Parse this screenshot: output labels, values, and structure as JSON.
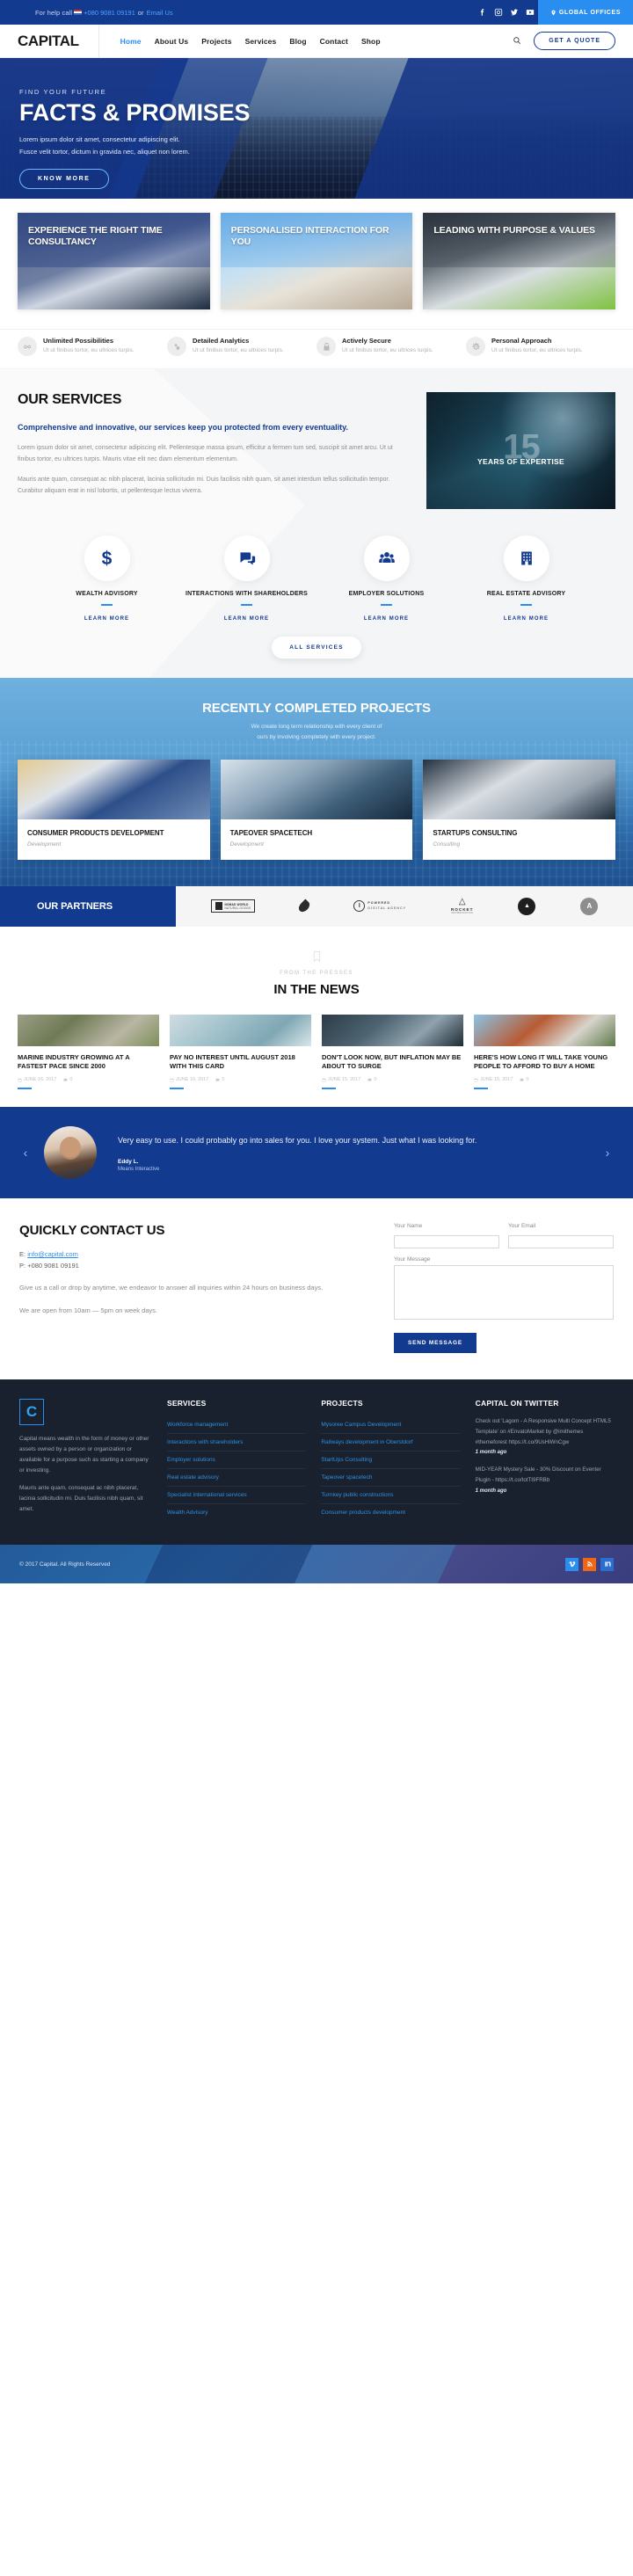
{
  "topbar": {
    "help_text": "For help call",
    "phone": "+080 9081 09191",
    "or_text": "or",
    "email_link": "Email Us",
    "social": [
      "facebook-icon",
      "instagram-icon",
      "twitter-icon",
      "youtube-icon"
    ],
    "global_offices": "GLOBAL OFFICES"
  },
  "nav": {
    "logo": "CAPITAL",
    "links": [
      {
        "label": "Home",
        "active": true
      },
      {
        "label": "About Us",
        "active": false
      },
      {
        "label": "Projects",
        "active": false
      },
      {
        "label": "Services",
        "active": false
      },
      {
        "label": "Blog",
        "active": false
      },
      {
        "label": "Contact",
        "active": false
      },
      {
        "label": "Shop",
        "active": false
      }
    ],
    "quote_button": "GET A QUOTE"
  },
  "hero": {
    "kicker": "FIND YOUR FUTURE",
    "title": "FACTS & PROMISES",
    "desc_line1": "Lorem ipsum dolor sit amet, consectetur adipiscing elit.",
    "desc_line2": "Fusce velit tortor, dictum in gravida nec, aliquet non lorem.",
    "button": "KNOW MORE"
  },
  "feature_cards": [
    {
      "title": "EXPERIENCE THE RIGHT TIME CONSULTANCY"
    },
    {
      "title": "PERSONALISED INTERACTION FOR YOU"
    },
    {
      "title": "LEADING WITH PURPOSE & VALUES"
    }
  ],
  "feature_strip": [
    {
      "icon": "infinity-icon",
      "title": "Unlimited Possibilities",
      "text": "Ut ut finibus tortor, eu ultrices turpis."
    },
    {
      "icon": "analytics-icon",
      "title": "Detailed Analytics",
      "text": "Ut ut finibus tortor, eu ultrices turpis."
    },
    {
      "icon": "lock-icon",
      "title": "Actively Secure",
      "text": "Ut ut finibus tortor, eu ultrices turpis."
    },
    {
      "icon": "gear-icon",
      "title": "Personal Approach",
      "text": "Ut ut finibus tortor, eu ultrices turpis."
    }
  ],
  "services": {
    "heading": "OUR SERVICES",
    "lead": "Comprehensive and innovative, our services keep you protected from every eventuality.",
    "para1": "Lorem ipsum dolor sit amet, consectetur adipiscing elit. Pellentesque massa ipsum, efficitur a fermen tum sed, suscipit sit amet arcu. Ut ut finibus tortor, eu ultrices turpis. Mauris vitae elit nec diam elementum elementum.",
    "para2": "Mauris ante quam, consequat ac nibh placerat, lacinia sollicitudin mi. Duis facilisis nibh quam, sit amet interdum tellus sollicitudin tempor. Curabitur aliquam erat in nisl lobortis, ut pellentesque lectus viverra.",
    "badge_number": "15",
    "badge_caption": "YEARS OF EXPERTISE",
    "items": [
      {
        "icon": "dollar-icon",
        "label": "WEALTH ADVISORY",
        "link": "LEARN MORE"
      },
      {
        "icon": "chat-icon",
        "label": "INTERACTIONS WITH SHAREHOLDERS",
        "link": "LEARN MORE"
      },
      {
        "icon": "people-icon",
        "label": "EMPLOYER SOLUTIONS",
        "link": "LEARN MORE"
      },
      {
        "icon": "building-icon",
        "label": "REAL ESTATE ADVISORY",
        "link": "LEARN MORE"
      }
    ],
    "all_services_button": "ALL SERVICES"
  },
  "projects": {
    "title": "RECENTLY COMPLETED PROJECTS",
    "sub_line1": "We create long term relationship with every client of",
    "sub_line2": "ours by involving completely with every project.",
    "cards": [
      {
        "title": "CONSUMER PRODUCTS DEVELOPMENT",
        "category": "Development"
      },
      {
        "title": "TAPEOVER SPACETECH",
        "category": "Development"
      },
      {
        "title": "STARTUPS CONSULTING",
        "category": "Consulting"
      }
    ]
  },
  "partners": {
    "label": "OUR PARTNERS",
    "logos": [
      {
        "name": "nomad-world-logo",
        "text1": "NOMAD WORLD",
        "text2": "NATURAL GOODS"
      },
      {
        "name": "drop-logo",
        "text1": "",
        "text2": ""
      },
      {
        "name": "powered-digital-agency-logo",
        "text1": "POWERED",
        "text2": "DIGITAL AGENCY"
      },
      {
        "name": "rocket-logo",
        "text1": "ROCKET",
        "text2": "CROWDFUNDING"
      },
      {
        "name": "badge-dark-logo",
        "text1": "",
        "text2": ""
      },
      {
        "name": "badge-gray-logo",
        "text1": "",
        "text2": ""
      }
    ]
  },
  "news": {
    "kicker": "FROM THE PRESSES",
    "title": "IN THE NEWS",
    "cards": [
      {
        "title": "MARINE INDUSTRY GROWING AT A FASTEST PACE SINCE 2000",
        "date": "JUNE 16, 2017",
        "comments": "0"
      },
      {
        "title": "PAY NO INTEREST UNTIL AUGUST 2018 WITH THIS CARD",
        "date": "JUNE 16, 2017",
        "comments": "0"
      },
      {
        "title": "DON'T LOOK NOW, BUT INFLATION MAY BE ABOUT TO SURGE",
        "date": "JUNE 15, 2017",
        "comments": "0"
      },
      {
        "title": "HERE'S HOW LONG IT WILL TAKE YOUNG PEOPLE TO AFFORD TO BUY A HOME",
        "date": "JUNE 15, 2017",
        "comments": "0"
      }
    ]
  },
  "testimonial": {
    "prev": "‹",
    "next": "›",
    "quote": "Very easy to use. I could probably go into sales for you. I love your system. Just what I was looking for.",
    "name": "Eddy L.",
    "role": "Means Interactive"
  },
  "contact": {
    "heading": "QUICKLY CONTACT US",
    "email_label": "E:",
    "email": "info@capital.com",
    "phone_label": "P:",
    "phone": "+080 9081 09191",
    "para1": "Give us a call or drop by anytime, we endeavor to answer all inquiries within 24 hours on business days.",
    "para2": "We are open from 10am — 5pm on week days.",
    "form": {
      "name_label": "Your Name",
      "name_value": "",
      "email_label": "Your Email",
      "email_value": "",
      "message_label": "Your Message",
      "message_value": "",
      "submit": "SEND MESSAGE"
    }
  },
  "footer": {
    "logo_letter": "C",
    "about_p1": "Capital means wealth in the form of money or other assets owned by a person or organization or available for a purpose such as starting a company or investing.",
    "about_p2": "Mauris ante quam, consequat ac nibh placerat, lacinia sollicitudin mi. Duis facilisis nibh quam, sit amet.",
    "services_heading": "SERVICES",
    "services": [
      "Workforce management",
      "Interactions with shareholders",
      "Employer solutions",
      "Real estate advisory",
      "Specialist international services",
      "Wealth Advisory"
    ],
    "projects_heading": "PROJECTS",
    "projects": [
      "Mysoree Campus Development",
      "Railways development in Oberstdorf",
      "StartUps Consulting",
      "Tapeover spacetech",
      "Turnkey public constructions",
      "Consumer products development"
    ],
    "twitter_heading": "CAPITAL ON TWITTER",
    "tweets": [
      {
        "text": "Check out 'Lagom - A Responsive Multi Concept HTML5 Template' on #EnvatoMarket by @imithemes #themeforest https://t.co/9UsHiWnCgw",
        "time": "1 month ago"
      },
      {
        "text": "MID-YEAR Mystery Sale - 30% Discount on Eventer Plugin - https://t.co/totTI9FRBb",
        "time": "1 month ago"
      }
    ],
    "copyright": "© 2017 Capital. All Rights Reserved",
    "social": [
      "vimeo-icon",
      "rss-icon",
      "linkedin-icon"
    ]
  },
  "colors": {
    "brand_navy": "#123a8f",
    "brand_blue": "#2a8ef0",
    "footer_dark": "#19212e"
  }
}
